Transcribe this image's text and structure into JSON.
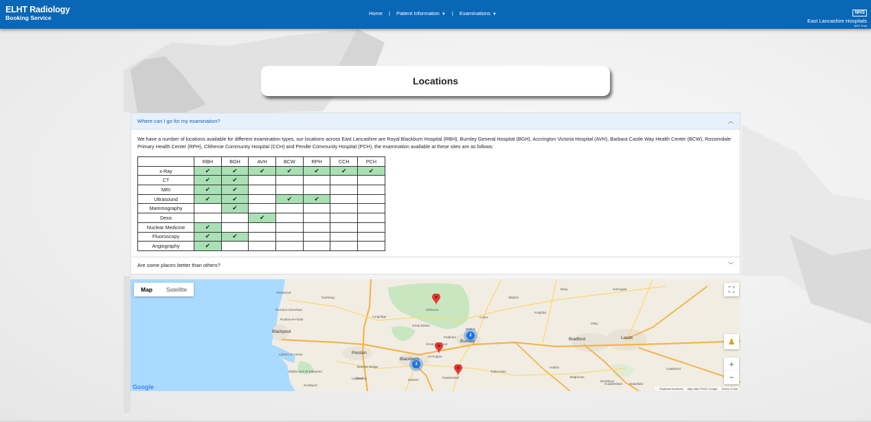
{
  "header": {
    "brand_title": "ELHT Radiology",
    "brand_subtitle": "Booking Service",
    "nav": [
      {
        "label": "Home"
      },
      {
        "label": "Patient Information"
      },
      {
        "label": "Examinations"
      }
    ],
    "nhs_logo": "NHS",
    "trust_name": "East Lancashire Hospitals",
    "trust_sub": "NHS Trust"
  },
  "page_title": "Locations",
  "accordion": {
    "q1": "Where can I go for my examination?",
    "q1_text": "We have a number of locations available for different examination types, our locations across East Lancashire are Royal Blackburn Hospital (RBH), Burnley General Hospital (BGH), Accrington Victoria Hospital (AVH), Barbara Castle Way Health Center (BCW), Rossendale Primary Health Center (RPH), Clitheroe Community Hospital (CCH) and Pendle Community Hospital (PCH), the examination available at these sites are as follows:",
    "q2": "Are some places better than others?"
  },
  "table": {
    "columns": [
      "RBH",
      "BGH",
      "AVH",
      "BCW",
      "RPH",
      "CCH",
      "PCH"
    ],
    "rows": [
      {
        "exam": "x-Ray",
        "avail": [
          1,
          1,
          1,
          1,
          1,
          1,
          1
        ]
      },
      {
        "exam": "CT",
        "avail": [
          1,
          1,
          0,
          0,
          0,
          0,
          0
        ]
      },
      {
        "exam": "MRI",
        "avail": [
          1,
          1,
          0,
          0,
          0,
          0,
          0
        ]
      },
      {
        "exam": "Ultrasound",
        "avail": [
          1,
          1,
          0,
          1,
          1,
          0,
          0
        ]
      },
      {
        "exam": "Mammography",
        "avail": [
          0,
          1,
          0,
          0,
          0,
          0,
          0
        ]
      },
      {
        "exam": "Dexa",
        "avail": [
          0,
          0,
          1,
          0,
          0,
          0,
          0
        ]
      },
      {
        "exam": "Nuclear Medicine",
        "avail": [
          1,
          0,
          0,
          0,
          0,
          0,
          0
        ]
      },
      {
        "exam": "Fluoroscopy",
        "avail": [
          1,
          1,
          0,
          0,
          0,
          0,
          0
        ]
      },
      {
        "exam": "Angiography",
        "avail": [
          1,
          0,
          0,
          0,
          0,
          0,
          0
        ]
      }
    ],
    "tick": "✔"
  },
  "map": {
    "type_map": "Map",
    "type_satellite": "Satellite",
    "google": "Google",
    "attribution": [
      "Keyboard shortcuts",
      "Map data ©2022 Google",
      "Terms of Use"
    ],
    "clusters": [
      "3",
      "2"
    ],
    "cities": [
      "Blackpool",
      "Preston",
      "Blackburn",
      "Burnley",
      "Bradford",
      "Leeds"
    ],
    "towns": [
      "Fleetwood",
      "Thornton-Cleveleys",
      "Poulton-le-Fylde",
      "Lytham St Annes",
      "Ribble and Alt Estuaries",
      "Southport",
      "Chorley",
      "Darwen",
      "Accrington",
      "Rawtenstall",
      "Todmorden",
      "Halifax",
      "Huddersfield",
      "Wakefield",
      "Keighley",
      "Skipton",
      "Ilkley",
      "Harrogate",
      "Clitheroe",
      "Colne",
      "Nelson",
      "Padiham",
      "Great Harwood",
      "Bamber Bridge",
      "Leyland",
      "Castleford",
      "Dewsbury",
      "Brighouse",
      "Otley",
      "Garstang",
      "Longridge",
      "Great Britain"
    ],
    "colors": {
      "pin": "#e53935",
      "cluster": "#1a73e8",
      "land": "#f1ede3",
      "sea": "#aadaff",
      "park": "#c8e6c0"
    }
  }
}
